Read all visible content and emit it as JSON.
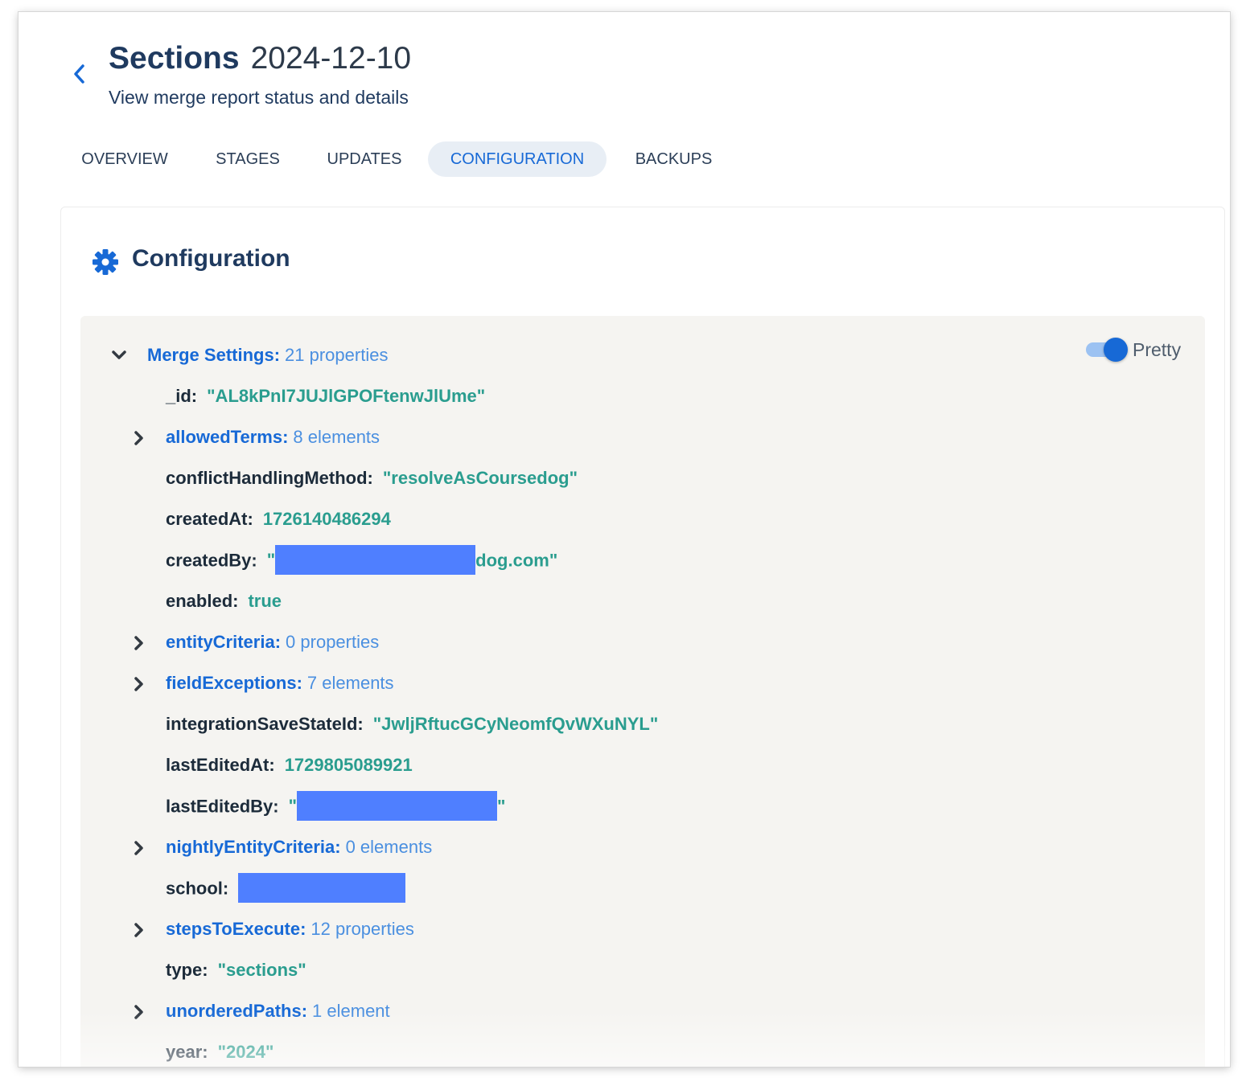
{
  "header": {
    "title": "Sections",
    "date": "2024-12-10",
    "subtitle": "View merge report status and details"
  },
  "tabs": [
    {
      "label": "OVERVIEW",
      "active": false
    },
    {
      "label": "STAGES",
      "active": false
    },
    {
      "label": "UPDATES",
      "active": false
    },
    {
      "label": "CONFIGURATION",
      "active": true
    },
    {
      "label": "BACKUPS",
      "active": false
    }
  ],
  "card": {
    "title": "Configuration",
    "icon": "gear-icon"
  },
  "toggle": {
    "label": "Pretty",
    "on": true
  },
  "colors": {
    "accent": "#1769d6",
    "value": "#2a9d8f",
    "redaction": "#4f7fff",
    "panel_bg": "#f5f4f1"
  },
  "tree": {
    "root": {
      "key": "Merge Settings:",
      "count": "21 properties",
      "expanded": true
    },
    "items": [
      {
        "type": "value",
        "key": "_id:",
        "value": "\"AL8kPnI7JUJlGPOFtenwJlUme\""
      },
      {
        "type": "group",
        "key": "allowedTerms:",
        "count": "8 elements"
      },
      {
        "type": "value",
        "key": "conflictHandlingMethod:",
        "value": "\"resolveAsCoursedog\""
      },
      {
        "type": "value",
        "key": "createdAt:",
        "value": "1726140486294"
      },
      {
        "type": "redacted",
        "key": "createdBy:",
        "prefix": "\"",
        "suffix": "dog.com\""
      },
      {
        "type": "value",
        "key": "enabled:",
        "value": "true"
      },
      {
        "type": "group",
        "key": "entityCriteria:",
        "count": "0 properties"
      },
      {
        "type": "group",
        "key": "fieldExceptions:",
        "count": "7 elements"
      },
      {
        "type": "value",
        "key": "integrationSaveStateId:",
        "value": "\"JwljRftucGCyNeomfQvWXuNYL\""
      },
      {
        "type": "value",
        "key": "lastEditedAt:",
        "value": "1729805089921"
      },
      {
        "type": "redacted",
        "key": "lastEditedBy:",
        "prefix": "\"",
        "suffix": "\""
      },
      {
        "type": "group",
        "key": "nightlyEntityCriteria:",
        "count": "0 elements"
      },
      {
        "type": "redacted",
        "key": "school:",
        "prefix": "",
        "suffix": ""
      },
      {
        "type": "group",
        "key": "stepsToExecute:",
        "count": "12 properties"
      },
      {
        "type": "value",
        "key": "type:",
        "value": "\"sections\""
      },
      {
        "type": "group",
        "key": "unorderedPaths:",
        "count": "1 element"
      },
      {
        "type": "value",
        "key": "year:",
        "value": "\"2024\""
      }
    ]
  }
}
